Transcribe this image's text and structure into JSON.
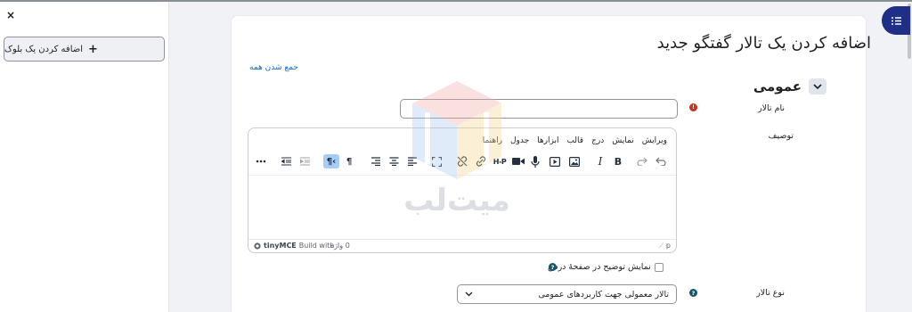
{
  "drawer": {
    "close_symbol": "×",
    "add_block_label": "اضافه کردن یک بلوک",
    "add_block_icon": "plus-icon"
  },
  "page": {
    "title": "اضافه کردن یک تالار گفتگو جدید",
    "collapse_all": "جمع شدن همه"
  },
  "section": {
    "title": "عمومی",
    "toggle_icon": "chevron-down-icon"
  },
  "fields": {
    "forum_name_label": "نام تالار",
    "forum_name_value": "",
    "description_label": "توصیف",
    "show_description_label": "نمایش توضیح در صفحهٔ درس",
    "forum_type_label": "نوع تالار",
    "forum_type_value": "تالار معمولی جهت کاربردهای عمومی"
  },
  "editor": {
    "menus": [
      "ویرایش",
      "نمایش",
      "درج",
      "قالب",
      "ابزارها",
      "جدول",
      "راهنما"
    ],
    "h5p_label": "H-P",
    "status_path": "p",
    "word_count": "0 واژه",
    "branding_build_with": "Build with",
    "branding_name": "tinyMCE"
  },
  "watermark": {
    "text": "میت‌لب"
  },
  "colors": {
    "accent": "#0f6cbf",
    "required": "#ca3120",
    "help": "#14566b",
    "rail": "#1f2f86",
    "active_tool": "#a6ccf7"
  }
}
